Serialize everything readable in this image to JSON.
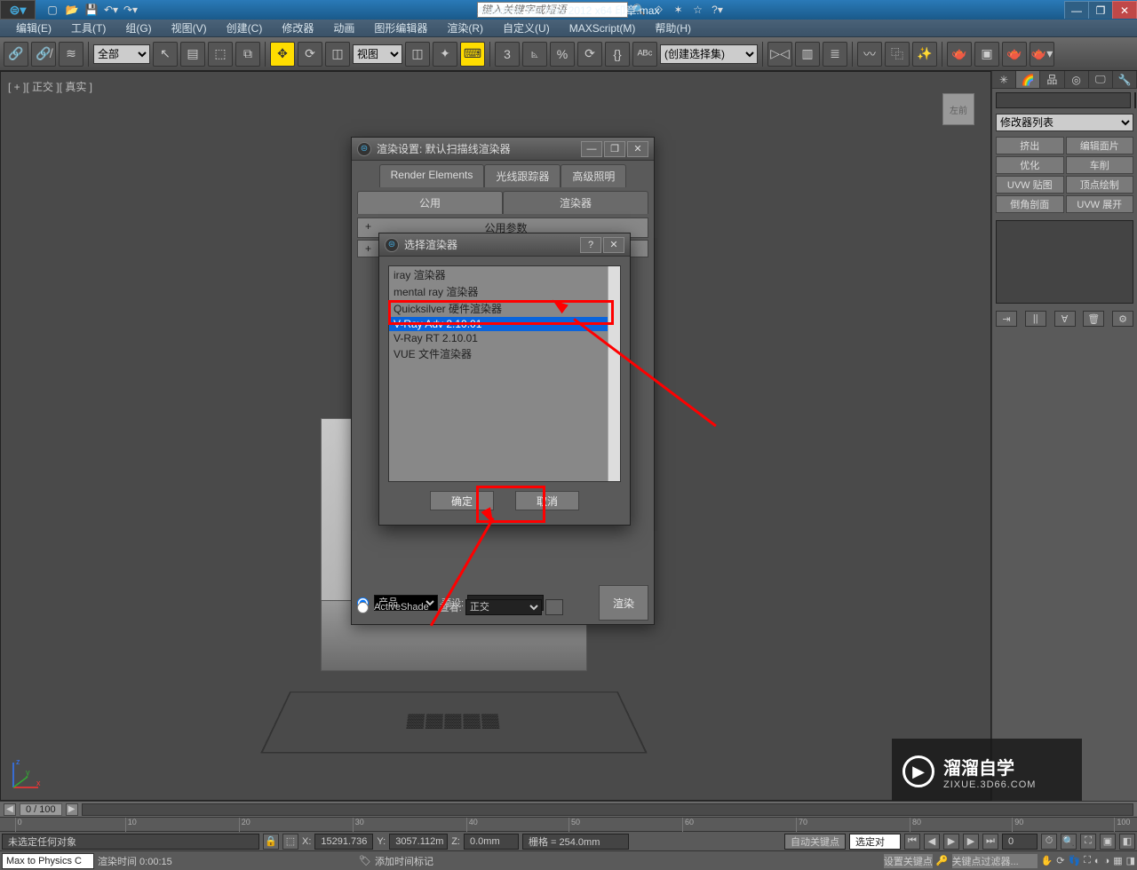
{
  "titlebar": {
    "app_title": "Autodesk 3ds Max  2012 x64      印章.max",
    "search_placeholder": "键入关键字或短语"
  },
  "menubar": {
    "items": [
      "编辑(E)",
      "工具(T)",
      "组(G)",
      "视图(V)",
      "创建(C)",
      "修改器",
      "动画",
      "图形编辑器",
      "渲染(R)",
      "自定义(U)",
      "MAXScript(M)",
      "帮助(H)"
    ]
  },
  "toolbar": {
    "sel_filter": "全部",
    "ref_system": "视图",
    "named_set_placeholder": "(创建选择集)"
  },
  "viewport": {
    "label": "[ + ][ 正交 ][ 真实 ]",
    "viewcube_face": "左前"
  },
  "rpanel": {
    "modifier_list_label": "修改器列表",
    "mod_buttons": [
      "挤出",
      "编辑面片",
      "优化",
      "车削",
      "UVW 贴图",
      "顶点绘制",
      "倒角剖面",
      "UVW 展开"
    ]
  },
  "timeline": {
    "current_label": "0 / 100",
    "ticks": [
      "0",
      "10",
      "20",
      "30",
      "40",
      "50",
      "60",
      "70",
      "80",
      "90",
      "100"
    ]
  },
  "statusbar": {
    "selection": "未选定任何对象",
    "coord_x_label": "X:",
    "coord_x": "15291.736",
    "coord_y_label": "Y:",
    "coord_y": "3057.112m",
    "coord_z_label": "Z:",
    "coord_z": "0.0mm",
    "grid": "栅格 = 254.0mm",
    "auto_key": "自动关键点",
    "selected_filter": "选定对"
  },
  "statusbar2": {
    "script_hint": "Max to Physics C",
    "render_time_label": "渲染时间  0:00:15",
    "add_time_tag": "添加时间标记",
    "set_key": "设置关键点",
    "key_filter": "关键点过滤器..."
  },
  "render_dialog": {
    "title": "渲染设置: 默认扫描线渲染器",
    "tabs_row1": [
      "Render Elements",
      "光线跟踪器",
      "高级照明"
    ],
    "tabs_row2": [
      "公用",
      "渲染器"
    ],
    "rollout1": "公用参数",
    "bottom": {
      "product_label": "产品",
      "activeshade_label": "ActiveShade",
      "preset_label": "预设:",
      "view_label": "查看:",
      "view_value": "正交",
      "render_btn": "渲染"
    }
  },
  "choose_dialog": {
    "title": "选择渲染器",
    "items": [
      "iray 渲染器",
      "mental ray 渲染器",
      "Quicksilver 硬件渲染器",
      "V-Ray Adv 2.10.01",
      "V-Ray RT 2.10.01",
      "VUE 文件渲染器"
    ],
    "selected_index": 3,
    "ok_btn": "确定",
    "cancel_btn": "取消"
  },
  "watermark": {
    "line1": "溜溜自学",
    "line2": "ZIXUE.3D66.COM"
  }
}
